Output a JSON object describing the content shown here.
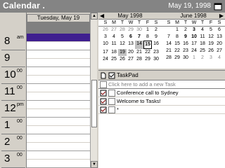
{
  "header": {
    "title": "Calendar .",
    "date": "May 19, 1998"
  },
  "dayview": {
    "column_header": "Tuesday, May 19",
    "hours": [
      {
        "num": "8",
        "suffix": "am"
      },
      {
        "num": "9",
        "suffix": ""
      },
      {
        "num": "10",
        "suffix": "00"
      },
      {
        "num": "11",
        "suffix": "00"
      },
      {
        "num": "12",
        "suffix": "pm"
      },
      {
        "num": "1",
        "suffix": "00"
      },
      {
        "num": "2",
        "suffix": "00"
      },
      {
        "num": "3",
        "suffix": "00"
      }
    ]
  },
  "calendar": {
    "months": [
      {
        "title": "May 1998",
        "dow": [
          "S",
          "M",
          "T",
          "W",
          "T",
          "F",
          "S"
        ],
        "days": [
          "26",
          "27",
          "28",
          "29",
          "30",
          "1",
          "2",
          "3",
          "4",
          "5",
          "6",
          "7",
          "8",
          "9",
          "10",
          "11",
          "12",
          "13",
          "14",
          "15",
          "16",
          "17",
          "18",
          "19",
          "20",
          "21",
          "22",
          "23",
          "24",
          "25",
          "26",
          "27",
          "28",
          "29",
          "30"
        ]
      },
      {
        "title": "June 1998",
        "dow": [
          "S",
          "M",
          "T",
          "W",
          "T",
          "F",
          "S"
        ],
        "days": [
          "",
          "1",
          "2",
          "3",
          "4",
          "5",
          "6",
          "7",
          "8",
          "9",
          "10",
          "11",
          "12",
          "13",
          "14",
          "15",
          "16",
          "17",
          "18",
          "19",
          "20",
          "21",
          "22",
          "23",
          "24",
          "25",
          "26",
          "27",
          "28",
          "29",
          "30",
          "1",
          "2",
          "3",
          "4"
        ]
      }
    ]
  },
  "taskpad": {
    "title": "TaskPad",
    "new_task_placeholder": "Click here to add a new Task",
    "tasks": [
      {
        "label": "Conference call to Sydney"
      },
      {
        "label": "Welcome to Tasks!"
      },
      {
        "label": "*"
      }
    ]
  }
}
